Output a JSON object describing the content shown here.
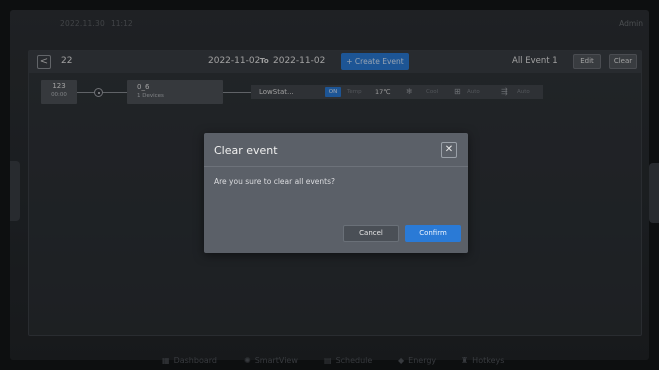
{
  "status_bar": {
    "date": "2022.11.30",
    "time": "11:12",
    "user": "Admin"
  },
  "toolbar": {
    "back_icon": "chevron-left-icon",
    "back_symbol": "<",
    "number": "22",
    "from_date": "2022-11-02",
    "to_label": "To",
    "to_date": "2022-11-02",
    "create_label": "+ Create Event",
    "group_label": "All Event 1",
    "edit_label": "Edit",
    "clear_label": "Clear"
  },
  "event_flow": {
    "box1_title": "123",
    "box1_time": "00:00",
    "box2_title": "0_6",
    "box2_devices": "1 Devices",
    "device": {
      "name": "LowStat...",
      "status": "ON",
      "temp_label": "Temp",
      "temp_value": "17℃",
      "mode_icon": "sun-icon",
      "mode_symbol": "❄",
      "mode_label": "Cool",
      "fan_icon": "fan-speed-icon",
      "fan_symbol": "⊞",
      "fan_label": "Auto",
      "swing_icon": "swing-icon",
      "swing_symbol": "⇶",
      "swing_label": "Auto"
    }
  },
  "dialog": {
    "title": "Clear event",
    "close_symbol": "✕",
    "message": "Are you sure to clear all events?",
    "cancel_label": "Cancel",
    "confirm_label": "Confirm"
  },
  "bottom_nav": {
    "items": [
      {
        "icon": "dashboard-icon",
        "symbol": "▦",
        "label": "Dashboard"
      },
      {
        "icon": "smartview-icon",
        "symbol": "✺",
        "label": "SmartView"
      },
      {
        "icon": "schedule-icon",
        "symbol": "▤",
        "label": "Schedule"
      },
      {
        "icon": "energy-icon",
        "symbol": "◆",
        "label": "Energy"
      },
      {
        "icon": "hotkeys-icon",
        "symbol": "♜",
        "label": "Hotkeys"
      }
    ]
  },
  "colors": {
    "accent": "#2a7ad6",
    "background": "#141618",
    "modal": "#5b6068"
  }
}
